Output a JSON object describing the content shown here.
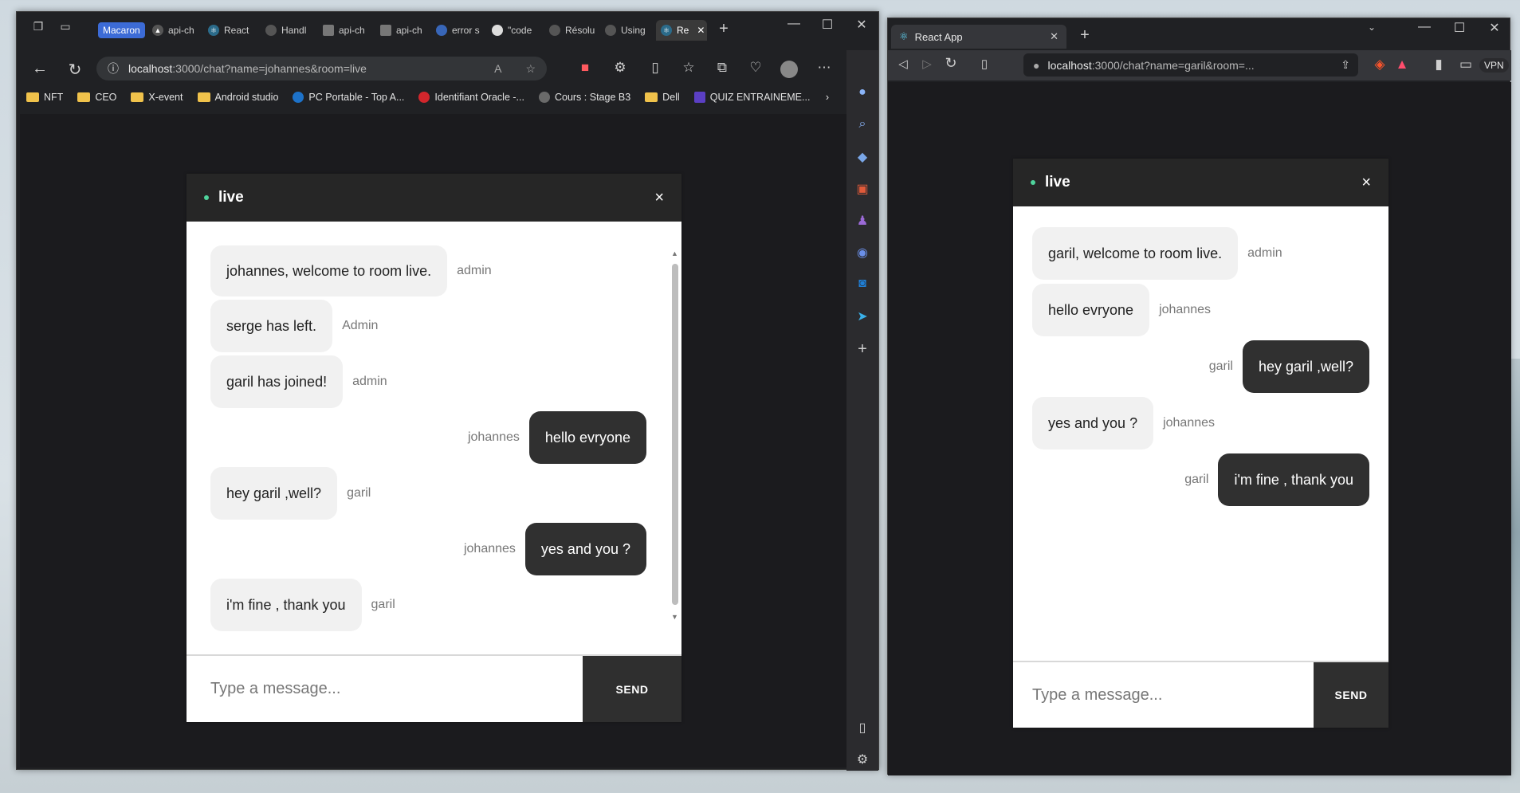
{
  "win1": {
    "tabs": [
      {
        "label": "Macaron"
      },
      {
        "label": "api-ch"
      },
      {
        "label": "React"
      },
      {
        "label": "Handl"
      },
      {
        "label": "api-ch"
      },
      {
        "label": "api-ch"
      },
      {
        "label": "error s"
      },
      {
        "label": "\"code"
      },
      {
        "label": "Résolu"
      },
      {
        "label": "Using"
      },
      {
        "label": "Re"
      }
    ],
    "url_host": "localhost",
    "url_rest": ":3000/chat?name=johannes&room=live",
    "bookmarks": [
      {
        "label": "NFT"
      },
      {
        "label": "CEO"
      },
      {
        "label": "X-event"
      },
      {
        "label": "Android studio"
      },
      {
        "label": "PC Portable - Top A..."
      },
      {
        "label": "Identifiant Oracle -..."
      },
      {
        "label": "Cours : Stage B3"
      },
      {
        "label": "Dell"
      },
      {
        "label": "QUIZ ENTRAINEME..."
      }
    ]
  },
  "win2": {
    "tab_title": "React App",
    "url_host": "localhost",
    "url_rest": ":3000/chat?name=garil&room=...",
    "vpn_label": "VPN"
  },
  "chat1": {
    "room": "live",
    "messages": [
      {
        "text": "johannes, welcome to room live.",
        "sender": "admin"
      },
      {
        "text": "serge has left.",
        "sender": "Admin"
      },
      {
        "text": "garil has joined!",
        "sender": "admin"
      },
      {
        "text": "hello evryone",
        "sender": "johannes"
      },
      {
        "text": "hey garil ,well?",
        "sender": "garil"
      },
      {
        "text": "yes and you ?",
        "sender": "johannes"
      },
      {
        "text": "i'm fine , thank you",
        "sender": "garil"
      }
    ],
    "placeholder": "Type a message...",
    "send_label": "SEND"
  },
  "chat2": {
    "room": "live",
    "messages": [
      {
        "text": "garil, welcome to room live.",
        "sender": "admin"
      },
      {
        "text": "hello evryone",
        "sender": "johannes"
      },
      {
        "text": "hey garil ,well?",
        "sender": "garil"
      },
      {
        "text": "yes and you ?",
        "sender": "johannes"
      },
      {
        "text": "i'm fine , thank you",
        "sender": "garil"
      }
    ],
    "placeholder": "Type a message...",
    "send_label": "SEND"
  },
  "colors": {
    "header_bg": "#262626",
    "own_bubble": "#303030",
    "other_bubble": "#f1f1f1",
    "online_dot": "#4fd39c"
  }
}
